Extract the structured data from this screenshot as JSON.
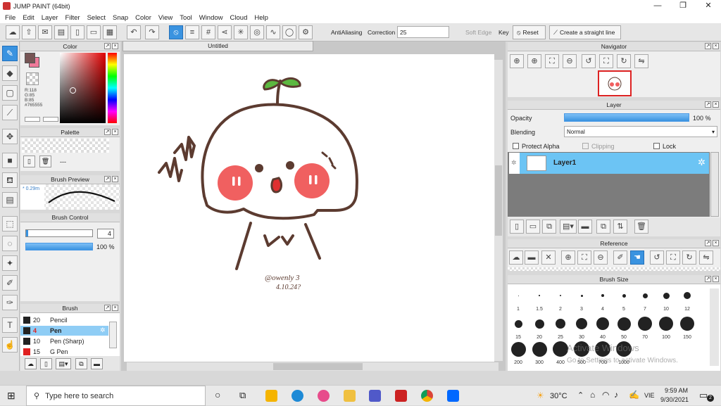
{
  "window": {
    "title": "JUMP PAINT (64bit)",
    "min": "—",
    "max": "❐",
    "close": "✕"
  },
  "menu": [
    "File",
    "Edit",
    "Layer",
    "Filter",
    "Select",
    "Snap",
    "Color",
    "View",
    "Tool",
    "Window",
    "Cloud",
    "Help"
  ],
  "toolbar": {
    "antialiasing_label": "AntiAliasing",
    "correction_label": "Correction",
    "correction_value": "25",
    "softedge_label": "Soft Edge",
    "key_label": "Key",
    "reset_label": "Reset",
    "straight_label": "Create a straight line"
  },
  "color_panel": {
    "title": "Color",
    "r": "R:118",
    "g": "G:85",
    "b": "B:85",
    "hex": "#765555",
    "fg": "#765555",
    "bg": "#f07a9a"
  },
  "palette_panel": {
    "title": "Palette",
    "placeholder": "---"
  },
  "brush_preview": {
    "title": "Brush Preview",
    "size": "* 0.29m"
  },
  "brush_control": {
    "title": "Brush Control",
    "size_value": "4",
    "opacity_value": "100 %"
  },
  "brush_panel": {
    "title": "Brush",
    "items": [
      {
        "size": "20",
        "name": "Pencil",
        "color": "#222222",
        "selected": false
      },
      {
        "size": "4",
        "name": "Pen",
        "color": "#222222",
        "selected": true
      },
      {
        "size": "10",
        "name": "Pen (Sharp)",
        "color": "#222222",
        "selected": false
      },
      {
        "size": "15",
        "name": "G Pen",
        "color": "#e02020",
        "selected": false
      }
    ]
  },
  "canvas": {
    "tab": "Untitled",
    "signature_line1": "@owenly 3",
    "signature_line2": "4.10.24?"
  },
  "navigator": {
    "title": "Navigator"
  },
  "layer_panel": {
    "title": "Layer",
    "opacity_label": "Opacity",
    "opacity_value": "100 %",
    "blending_label": "Blending",
    "blending_value": "Normal",
    "protect_alpha": "Protect Alpha",
    "clipping": "Clipping",
    "lock": "Lock",
    "layers": [
      {
        "name": "Layer1"
      }
    ]
  },
  "reference": {
    "title": "Reference"
  },
  "brush_size": {
    "title": "Brush Size",
    "sizes": [
      "1",
      "1.5",
      "2",
      "3",
      "4",
      "5",
      "7",
      "10",
      "12",
      "15",
      "20",
      "25",
      "30",
      "40",
      "50",
      "70",
      "100",
      "150",
      "200",
      "300",
      "400",
      "500",
      "700",
      "1000"
    ]
  },
  "watermark": {
    "line1": "Activate Windows",
    "line2": "Go to Settings to activate Windows."
  },
  "taskbar": {
    "search_placeholder": "Type here to search",
    "weather": "30°C",
    "lang": "VIE",
    "time": "9:59 AM",
    "date": "9/30/2021",
    "notif": "2"
  }
}
